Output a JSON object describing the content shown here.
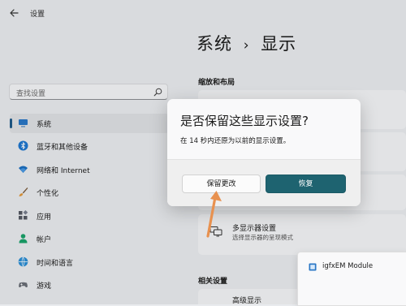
{
  "window": {
    "title": "设置"
  },
  "header": {
    "breadcrumb_parent": "系统",
    "breadcrumb_separator": "›",
    "breadcrumb_current": "显示"
  },
  "sidebar": {
    "search": {
      "placeholder": "查找设置"
    },
    "items": [
      {
        "label": "系统",
        "icon": "monitor-icon",
        "selected": true
      },
      {
        "label": "蓝牙和其他设备",
        "icon": "bluetooth-icon",
        "selected": false
      },
      {
        "label": "网络和 Internet",
        "icon": "wifi-icon",
        "selected": false
      },
      {
        "label": "个性化",
        "icon": "brush-icon",
        "selected": false
      },
      {
        "label": "应用",
        "icon": "apps-icon",
        "selected": false
      },
      {
        "label": "帐户",
        "icon": "person-icon",
        "selected": false
      },
      {
        "label": "时间和语言",
        "icon": "globe-clock-icon",
        "selected": false
      },
      {
        "label": "游戏",
        "icon": "gamepad-icon",
        "selected": false
      }
    ]
  },
  "main": {
    "section_title": "缩放和布局",
    "multi_display": {
      "title": "多显示器设置",
      "subtitle": "选择显示器的呈现模式",
      "icon": "multi-monitor-icon"
    },
    "related_title": "相关设置",
    "related_row_label": "高级显示"
  },
  "dialog": {
    "title": "是否保留这些显示设置?",
    "message": "在 14 秒内还原为以前的显示设置。",
    "countdown_seconds": 14,
    "keep_label": "保留更改",
    "revert_label": "恢复"
  },
  "toast": {
    "text": "igfxEM Module",
    "icon": "app-icon"
  },
  "colors": {
    "accent": "#1e6370",
    "selection_indicator": "#1f5b8a",
    "annotation_arrow": "#e8914f"
  }
}
